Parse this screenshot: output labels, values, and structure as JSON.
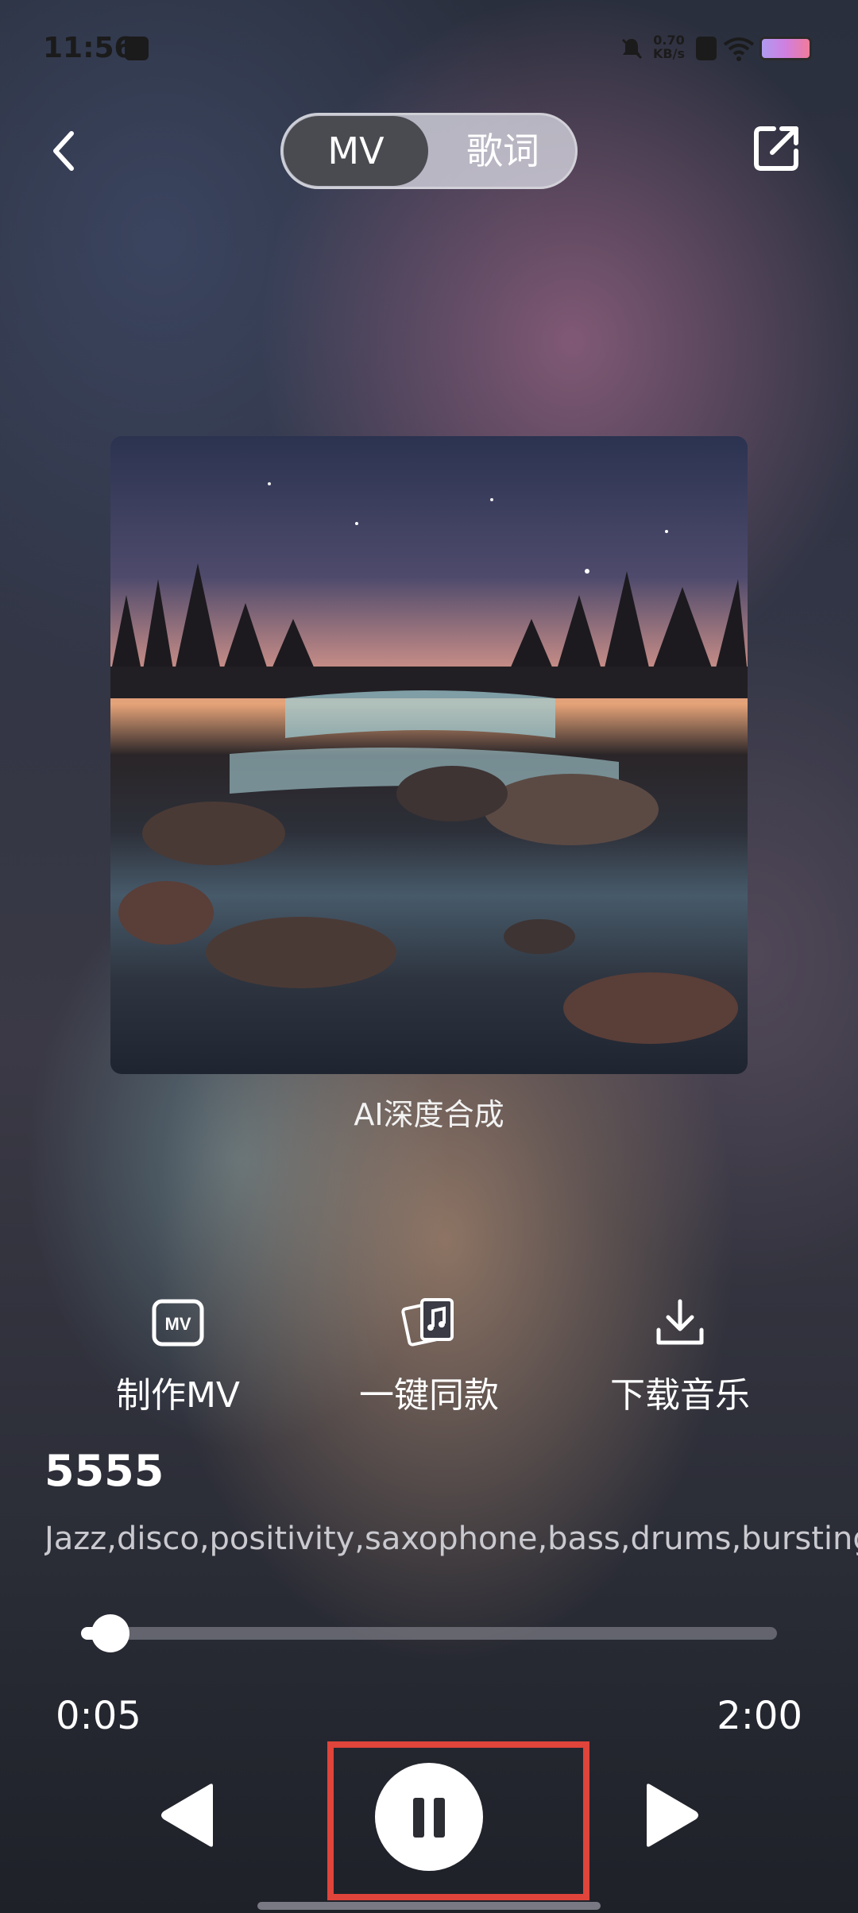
{
  "status_bar": {
    "time": "11:56",
    "net_speed_value": "0.70",
    "net_speed_unit": "KB/s"
  },
  "header": {
    "tabs": [
      {
        "label": "MV",
        "selected": true
      },
      {
        "label": "歌词",
        "selected": false
      }
    ]
  },
  "cover": {
    "caption": "AI深度合成"
  },
  "actions": [
    {
      "label": "制作MV",
      "icon": "mv-icon"
    },
    {
      "label": "一键同款",
      "icon": "music-cards-icon"
    },
    {
      "label": "下载音乐",
      "icon": "download-icon"
    }
  ],
  "song": {
    "title": "5555",
    "tags": "Jazz,disco,positivity,saxophone,bass,drums,bursting·"
  },
  "player": {
    "current_time": "0:05",
    "total_time": "2:00",
    "progress_fraction": 0.042,
    "state": "playing"
  },
  "colors": {
    "highlight": "#e0443a",
    "accent": "#ffffff"
  }
}
